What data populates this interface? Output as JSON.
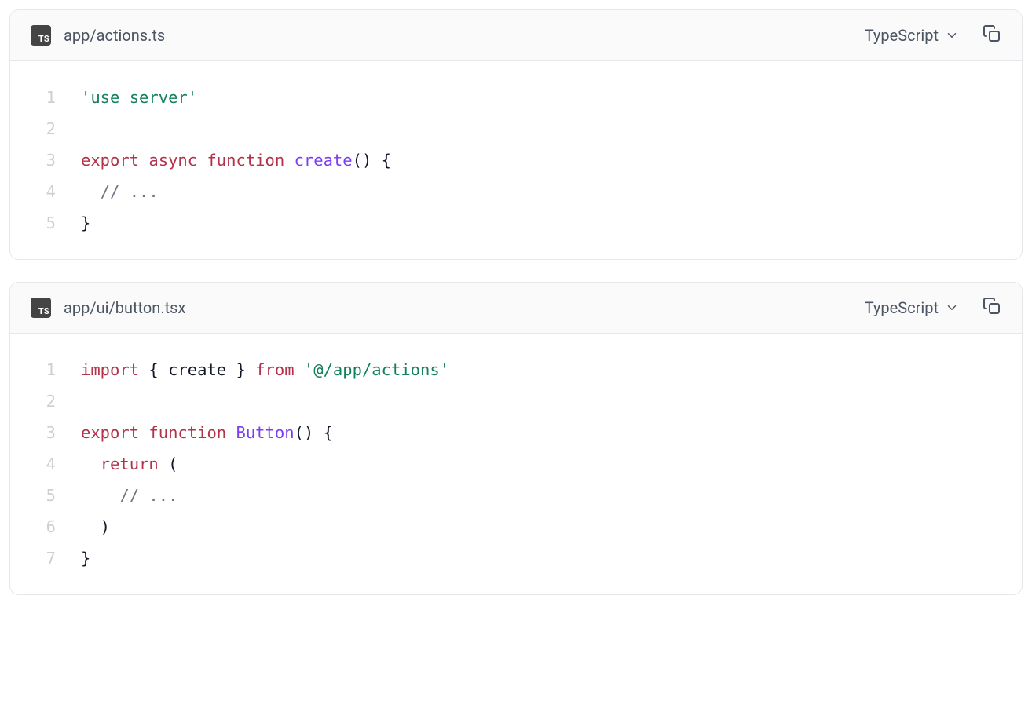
{
  "blocks": [
    {
      "badge": "TS",
      "filename": "app/actions.ts",
      "language": "TypeScript",
      "lines": [
        [
          {
            "c": "str",
            "t": "'use server'"
          }
        ],
        [],
        [
          {
            "c": "kw",
            "t": "export"
          },
          {
            "c": "punct",
            "t": " "
          },
          {
            "c": "kw",
            "t": "async"
          },
          {
            "c": "punct",
            "t": " "
          },
          {
            "c": "kw",
            "t": "function"
          },
          {
            "c": "punct",
            "t": " "
          },
          {
            "c": "fn",
            "t": "create"
          },
          {
            "c": "punct",
            "t": "() {"
          }
        ],
        [
          {
            "c": "punct",
            "t": "  "
          },
          {
            "c": "comm",
            "t": "// ..."
          }
        ],
        [
          {
            "c": "punct",
            "t": "}"
          }
        ]
      ]
    },
    {
      "badge": "TS",
      "filename": "app/ui/button.tsx",
      "language": "TypeScript",
      "lines": [
        [
          {
            "c": "kw",
            "t": "import"
          },
          {
            "c": "punct",
            "t": " { "
          },
          {
            "c": "ident",
            "t": "create"
          },
          {
            "c": "punct",
            "t": " } "
          },
          {
            "c": "kw",
            "t": "from"
          },
          {
            "c": "punct",
            "t": " "
          },
          {
            "c": "str",
            "t": "'@/app/actions'"
          }
        ],
        [],
        [
          {
            "c": "kw",
            "t": "export"
          },
          {
            "c": "punct",
            "t": " "
          },
          {
            "c": "kw",
            "t": "function"
          },
          {
            "c": "punct",
            "t": " "
          },
          {
            "c": "fn",
            "t": "Button"
          },
          {
            "c": "punct",
            "t": "() {"
          }
        ],
        [
          {
            "c": "punct",
            "t": "  "
          },
          {
            "c": "kw",
            "t": "return"
          },
          {
            "c": "punct",
            "t": " ("
          }
        ],
        [
          {
            "c": "punct",
            "t": "    "
          },
          {
            "c": "comm",
            "t": "// ..."
          }
        ],
        [
          {
            "c": "punct",
            "t": "  )"
          }
        ],
        [
          {
            "c": "punct",
            "t": "}"
          }
        ]
      ]
    }
  ]
}
